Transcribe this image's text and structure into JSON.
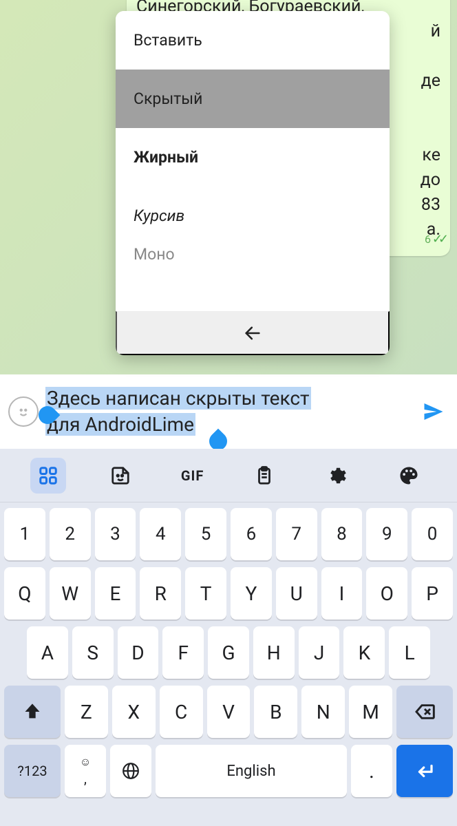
{
  "message": {
    "line1": "Синегорский, Богураевский,",
    "fragment_y": "й",
    "fragment_de": "де",
    "fragment_ke": "ке",
    "fragment_do": "до",
    "fragment_83": "83",
    "fragment_a": "а.",
    "time_suffix": "6"
  },
  "context_menu": {
    "paste": "Вставить",
    "hidden": "Скрытый",
    "bold": "Жирный",
    "italic": "Курсив",
    "mono_partial": "Моно"
  },
  "input": {
    "line1": "Здесь написан скрыты текст",
    "line2": "для AndroidLime"
  },
  "keyboard": {
    "gif_label": "GIF",
    "row_nums": [
      "1",
      "2",
      "3",
      "4",
      "5",
      "6",
      "7",
      "8",
      "9",
      "0"
    ],
    "row1": [
      "Q",
      "W",
      "E",
      "R",
      "T",
      "Y",
      "U",
      "I",
      "O",
      "P"
    ],
    "row2": [
      "A",
      "S",
      "D",
      "F",
      "G",
      "H",
      "J",
      "K",
      "L"
    ],
    "row3": [
      "Z",
      "X",
      "C",
      "V",
      "B",
      "N",
      "M"
    ],
    "sym": "?123",
    "comma_top": "☺",
    "comma": ",",
    "space": "English",
    "period": "."
  }
}
